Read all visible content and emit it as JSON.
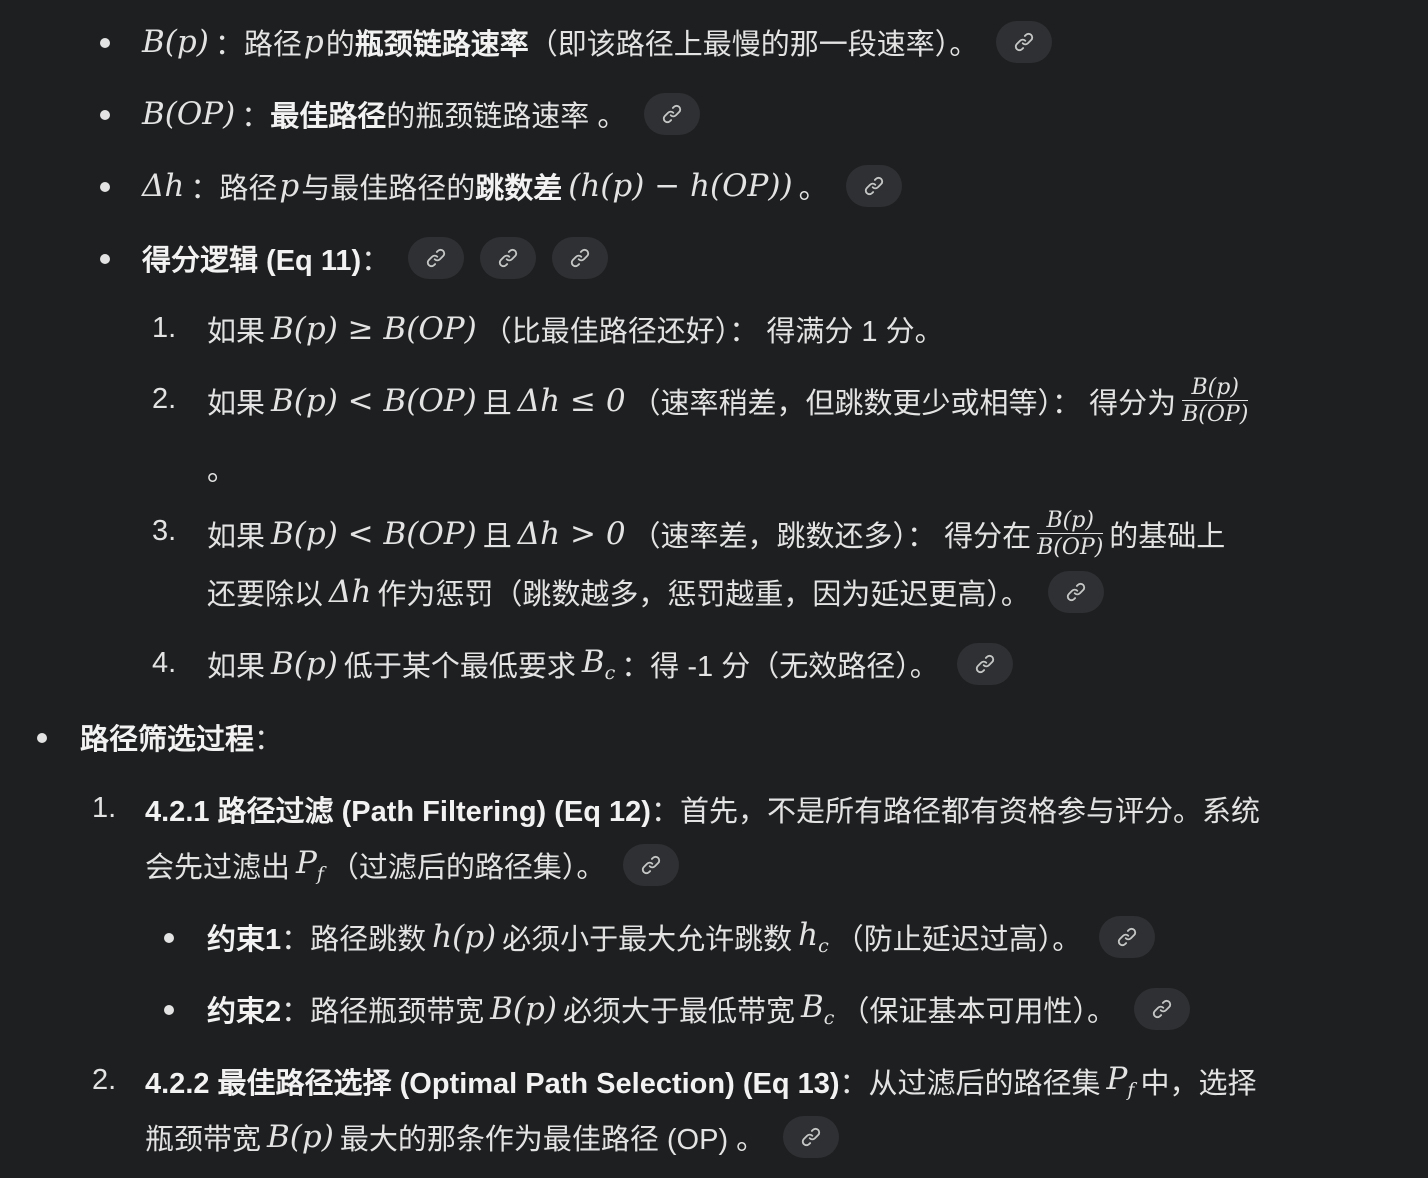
{
  "items": {
    "b_p": {
      "math": "B(p)",
      "colon": "：路径 ",
      "math_p": "p",
      "text1": " 的",
      "bold": "瓶颈链路速率",
      "text2": "（即该路径上最慢的那一段速率）。"
    },
    "b_op": {
      "math": "B(OP)",
      "colon": "：",
      "bold": "最佳路径",
      "text": "的瓶颈链路速率 。"
    },
    "delta_h": {
      "math": "Δh",
      "colon": "：路径 ",
      "math_p": "p",
      "text1": " 与最佳路径的",
      "bold": "跳数差",
      "text2": " ",
      "math_expr": "(h(p) − h(OP))",
      "text3": " 。"
    },
    "scoring": {
      "bold": "得分逻辑 (Eq 11)",
      "text": "："
    },
    "rules": [
      {
        "num": "1.",
        "t1": "如果 ",
        "m1": "B(p) ≥ B(OP)",
        "t2": "（比最佳路径还好）： 得满分 1 分。"
      },
      {
        "num": "2.",
        "t1": "如果 ",
        "m1": "B(p) < B(OP)",
        "t2": " 且 ",
        "m2": "Δh ≤ 0",
        "t3": "（速率稍差，但跳数更少或相等）： 得分为 ",
        "frac_num": "B(p)",
        "frac_den": "B(OP)",
        "t4": "。"
      },
      {
        "num": "3.",
        "t1": "如果 ",
        "m1": "B(p) < B(OP)",
        "t2": " 且 ",
        "m2": "Δh > 0",
        "t3": "（速率差，跳数还多）： 得分在 ",
        "frac_num": "B(p)",
        "frac_den": "B(OP)",
        "t4": " 的基础上",
        "line2_t1": "还要除以 ",
        "line2_m": "Δh",
        "line2_t2": " 作为惩罚（跳数越多，惩罚越重，因为延迟更高）。"
      },
      {
        "num": "4.",
        "t1": "如果 ",
        "m1": "B(p)",
        "t2": " 低于某个最低要求 ",
        "m2": "B",
        "m2_sub": "c",
        "t3": "：得 -1 分（无效路径）。"
      }
    ],
    "filtering": {
      "bold": "路径筛选过程",
      "text": "："
    },
    "steps": [
      {
        "num": "1.",
        "bold": "4.2.1 路径过滤 (Path Filtering) (Eq 12)",
        "t1": "：首先，不是所有路径都有资格参与评分。系统",
        "line2_t1": "会先过滤出 ",
        "line2_m": "P",
        "line2_sub": "f",
        "line2_t2": "（过滤后的路径集）。"
      },
      {
        "num": "2.",
        "bold": "4.2.2 最佳路径选择 (Optimal Path Selection) (Eq 13)",
        "t1": "：从过滤后的路径集 ",
        "m1": "P",
        "m1_sub": "f",
        "t2": " 中，选择",
        "line2_t1": "瓶颈带宽 ",
        "line2_m": "B(p)",
        "line2_t2": " 最大的那条作为最佳路径 (OP) 。"
      }
    ],
    "constraints": [
      {
        "bold": "约束1",
        "t1": "：路径跳数 ",
        "m1": "h(p)",
        "t2": " 必须小于最大允许跳数 ",
        "m2": "h",
        "m2_sub": "c",
        "t3": "（防止延迟过高）。"
      },
      {
        "bold": "约束2",
        "t1": "：路径瓶颈带宽 ",
        "m1": "B(p)",
        "t2": " 必须大于最低带宽 ",
        "m2": "B",
        "m2_sub": "c",
        "t3": "（保证基本可用性）。"
      }
    ]
  },
  "icons": {
    "link": "link-icon"
  },
  "colors": {
    "background": "#1e1f20",
    "text": "#e3e3e3",
    "chip": "#2e3033"
  }
}
